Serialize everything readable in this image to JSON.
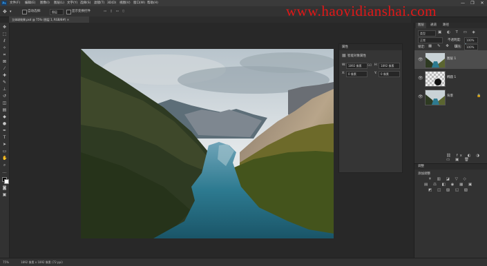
{
  "app": {
    "logo": "Ps"
  },
  "menu": [
    "文件(F)",
    "编辑(E)",
    "图像(I)",
    "图层(L)",
    "文字(Y)",
    "选择(S)",
    "滤镜(T)",
    "3D(D)",
    "视图(V)",
    "窗口(W)",
    "帮助(H)"
  ],
  "window_controls": [
    "—",
    "❐",
    "✕"
  ],
  "options_bar": {
    "move_icon": "move-tool-icon",
    "auto_select_label": "自动选择:",
    "auto_select_value": "图层",
    "show_transform_label": "显示变换控件"
  },
  "watermark": "www.haoyidianshai.com",
  "document_tab": {
    "title": "立体球效果.psd @ 75% (图层 1, RGB/8#) ×"
  },
  "properties_panel": {
    "title": "属性",
    "section": "智能对象属性",
    "w_label": "W:",
    "w_value": "1892 像素",
    "link_label": "GO",
    "h_label": "H:",
    "h_value": "1892 像素",
    "x_label": "X:",
    "x_value": "0 像素",
    "y_label": "Y:",
    "y_value": "0 像素"
  },
  "right_panel": {
    "tabs": [
      "图层",
      "通道",
      "路径"
    ],
    "filter_label": "类型",
    "blend_mode": "正常",
    "opacity_label": "不透明度:",
    "opacity_value": "100%",
    "lock_label": "锁定:",
    "fill_label": "填充:",
    "fill_value": "100%",
    "layers": [
      {
        "name": "图层 1",
        "thumb": "landscape",
        "selected": true
      },
      {
        "name": "椭圆 1",
        "thumb": "ellipse",
        "selected": false
      },
      {
        "name": "背景",
        "thumb": "landscape",
        "selected": false
      }
    ],
    "adjust_title": "调整",
    "adjust_subtitle": "添加调整"
  },
  "status_bar": {
    "zoom": "75%",
    "doc_info": "1892 像素 x 1892 像素 (72 ppi)"
  },
  "colors": {
    "watermark": "#e01818",
    "selected_layer": "#4d4d4d",
    "panel": "#323232",
    "canvas": "#282828"
  }
}
